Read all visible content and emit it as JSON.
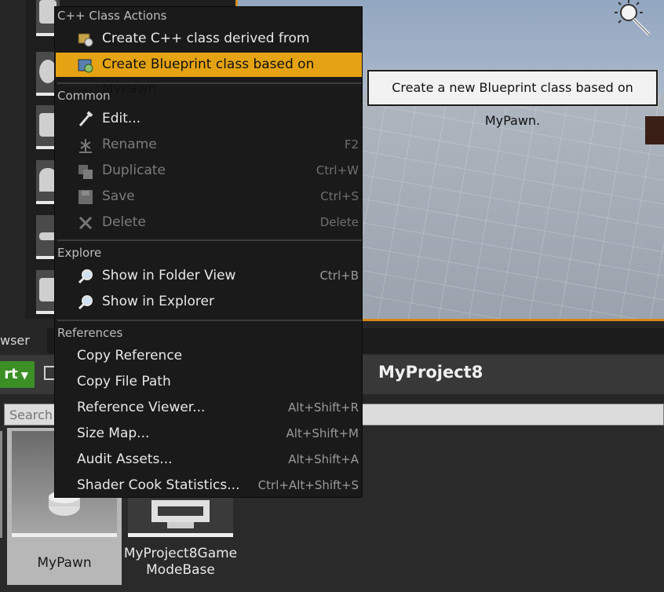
{
  "viewport": {
    "accent_color": "#d68a1a"
  },
  "content_browser": {
    "tab_label": "wser",
    "add_button_label": "rt",
    "path_label": "MyProject8",
    "search_placeholder": "Search",
    "assets": [
      {
        "name": "MyPawn",
        "selected": true
      },
      {
        "name": "MyProject8Game ModeBase",
        "line1": "MyProject8Game",
        "line2": "ModeBase",
        "selected": false
      }
    ]
  },
  "context_menu": {
    "sections": [
      {
        "header": "C++ Class Actions",
        "items": [
          {
            "label": "Create C++ class derived from MyPawn",
            "icon": "cpp-class-icon",
            "shortcut": "",
            "enabled": true
          },
          {
            "label": "Create Blueprint class based on MyPawn",
            "icon": "blueprint-class-icon",
            "shortcut": "",
            "enabled": true,
            "highlighted": true
          }
        ]
      },
      {
        "header": "Common",
        "items": [
          {
            "label": "Edit...",
            "icon": "edit-icon",
            "shortcut": "",
            "enabled": true
          },
          {
            "label": "Rename",
            "icon": "rename-icon",
            "shortcut": "F2",
            "enabled": false
          },
          {
            "label": "Duplicate",
            "icon": "duplicate-icon",
            "shortcut": "Ctrl+W",
            "enabled": false
          },
          {
            "label": "Save",
            "icon": "save-icon",
            "shortcut": "Ctrl+S",
            "enabled": false
          },
          {
            "label": "Delete",
            "icon": "delete-icon",
            "shortcut": "Delete",
            "enabled": false
          }
        ]
      },
      {
        "header": "Explore",
        "items": [
          {
            "label": "Show in Folder View",
            "icon": "magnifier-icon",
            "shortcut": "Ctrl+B",
            "enabled": true
          },
          {
            "label": "Show in Explorer",
            "icon": "magnifier-icon",
            "shortcut": "",
            "enabled": true
          }
        ]
      },
      {
        "header": "References",
        "items": [
          {
            "label": "Copy Reference",
            "shortcut": "",
            "enabled": true
          },
          {
            "label": "Copy File Path",
            "shortcut": "",
            "enabled": true
          },
          {
            "label": "Reference Viewer...",
            "shortcut": "Alt+Shift+R",
            "enabled": true
          },
          {
            "label": "Size Map...",
            "shortcut": "Alt+Shift+M",
            "enabled": true
          },
          {
            "label": "Audit Assets...",
            "shortcut": "Alt+Shift+A",
            "enabled": true
          },
          {
            "label": "Shader Cook Statistics...",
            "shortcut": "Ctrl+Alt+Shift+S",
            "enabled": true
          }
        ]
      }
    ],
    "highlight_color": "#e5a313"
  },
  "tooltip": {
    "text": "Create a new Blueprint class based on MyPawn."
  }
}
